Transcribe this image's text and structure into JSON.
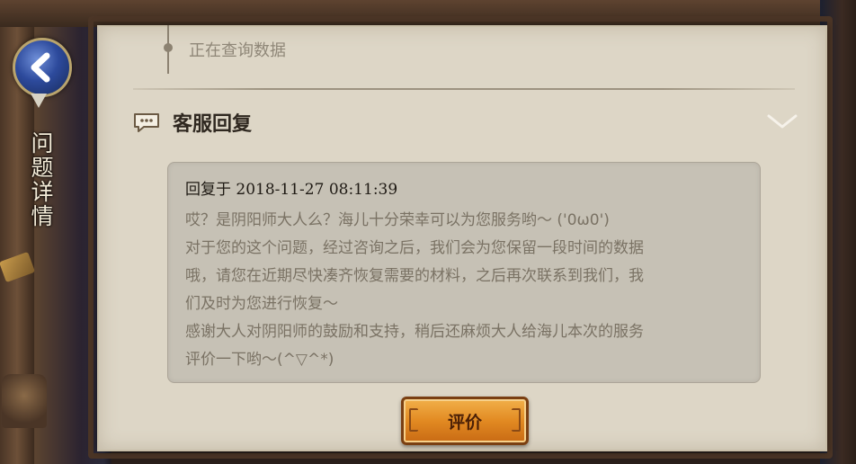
{
  "page": {
    "title": "问题详情"
  },
  "timeline": {
    "status_text": "正在查询数据"
  },
  "section": {
    "title": "客服回复",
    "icon": "chat-bubble-icon",
    "collapse_icon": "chevron-down-icon"
  },
  "reply": {
    "header": "回复于 2018-11-27 08:11:39",
    "lines": [
      "哎？是阴阳师大人么？海儿十分荣幸可以为您服务哟～ ('0ω0')",
      "对于您的这个问题，经过咨询之后，我们会为您保留一段时间的数据",
      "哦，请您在近期尽快凑齐恢复需要的材料，之后再次联系到我们，我",
      "们及时为您进行恢复～",
      "感谢大人对阴阳师的鼓励和支持，稍后还麻烦大人给海儿本次的服务",
      "评价一下哟～(^▽^*)"
    ]
  },
  "actions": {
    "rate_label": "评价"
  },
  "colors": {
    "panel": "#ddd6c6",
    "reply_box": "#c6c1b5",
    "button": "#e28a22",
    "back_button": "#2d4a9c"
  }
}
